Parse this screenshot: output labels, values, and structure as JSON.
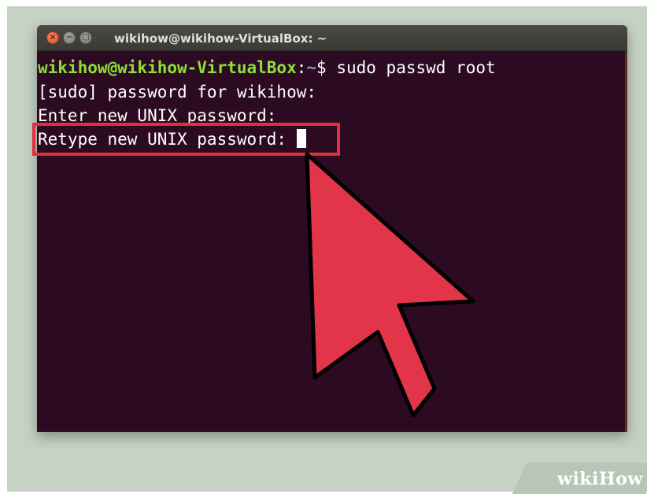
{
  "window": {
    "title": "wikihow@wikihow-VirtualBox: ~",
    "buttons": {
      "close": "×",
      "minimize": "−",
      "maximize": "□"
    }
  },
  "terminal": {
    "prompt_user_host": "wikihow@wikihow-VirtualBox",
    "prompt_sep": ":",
    "prompt_path": "~",
    "prompt_symbol": "$ ",
    "command": "sudo passwd root",
    "lines": [
      "[sudo] password for wikihow:",
      "Enter new UNIX password:",
      "Retype new UNIX password: "
    ]
  },
  "colors": {
    "terminal_bg": "#2c0a22",
    "prompt_green": "#8ae234",
    "prompt_blue": "#729fcf",
    "highlight_red": "#e02f3e",
    "arrow_red": "#e3354a"
  },
  "watermark": {
    "wiki": "wiki",
    "how": "How"
  },
  "annotations": {
    "arrow_icon": "pointer-arrow-icon"
  }
}
